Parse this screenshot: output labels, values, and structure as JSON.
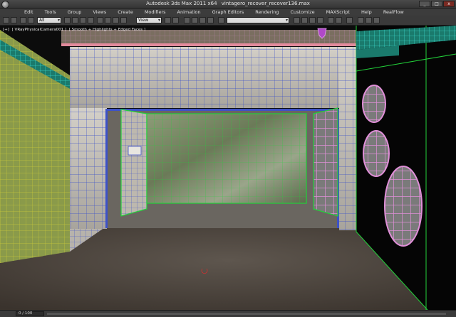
{
  "window": {
    "app_title": "Autodesk 3ds Max  2011 x64",
    "file_name": "vintagero_recover_recover136.max",
    "controls": [
      "_",
      "□",
      "x"
    ]
  },
  "menu": {
    "items": [
      "Edit",
      "Tools",
      "Group",
      "Views",
      "Create",
      "Modifiers",
      "Animation",
      "Graph Editors",
      "Rendering",
      "Customize",
      "MAXScript",
      "Help",
      "RealFlow"
    ]
  },
  "toolbar": {
    "selection_filter": "All",
    "reference_coord": "View",
    "named_selection": ""
  },
  "viewport": {
    "label_parts": [
      "[+]",
      "[ VRayPhysicalCamera001 ]",
      "[ Smooth + Highlights + Edged Faces ]"
    ],
    "label_text": "[+] [ VRayPhysicalCamera001 ] [ Smooth + Highlights + Edged Faces ]"
  },
  "statusbar": {
    "frame_counter": "0 / 100"
  },
  "colors": {
    "floor": "#4e4640",
    "wall_light": "#c8c4bc",
    "mossy_panel": "#6f7a5c",
    "wireframe_blue": "#3d52c8",
    "wireframe_green": "#22d13a",
    "wireframe_pink": "#e08fd8",
    "wireframe_yellow": "#c8c83a",
    "wireframe_cyan": "#3ad6c8",
    "wall_black": "#050505"
  }
}
